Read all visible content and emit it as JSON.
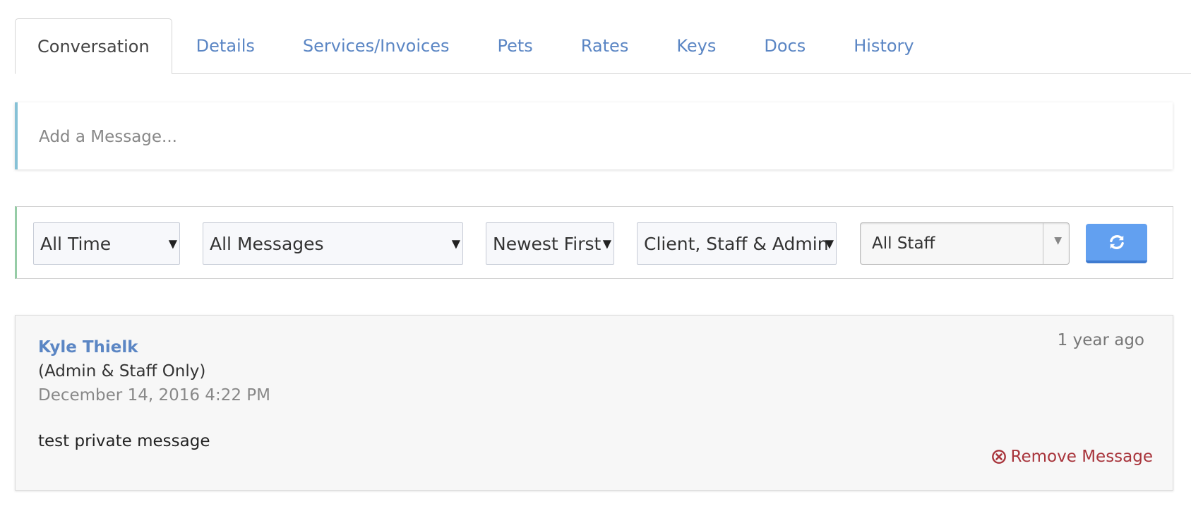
{
  "tabs": [
    {
      "label": "Conversation",
      "active": true
    },
    {
      "label": "Details",
      "active": false
    },
    {
      "label": "Services/Invoices",
      "active": false
    },
    {
      "label": "Pets",
      "active": false
    },
    {
      "label": "Rates",
      "active": false
    },
    {
      "label": "Keys",
      "active": false
    },
    {
      "label": "Docs",
      "active": false
    },
    {
      "label": "History",
      "active": false
    }
  ],
  "composer": {
    "placeholder": "Add a Message..."
  },
  "filters": {
    "time": "All Time",
    "message_type": "All Messages",
    "sort": "Newest First",
    "audience": "Client, Staff & Admin",
    "staff": "All Staff",
    "refresh_icon": "refresh-icon"
  },
  "message": {
    "author": "Kyle Thielk",
    "visibility": "(Admin & Staff Only)",
    "timestamp": "December 14, 2016 4:22 PM",
    "relative_time": "1 year ago",
    "body": "test private message",
    "remove_label": "Remove Message",
    "remove_icon": "remove-circle-icon"
  },
  "colors": {
    "link": "#5b86c4",
    "danger": "#a8343b",
    "button": "#62a0f0",
    "composer_accent": "#86c1d6",
    "filter_accent": "#96cca6"
  }
}
